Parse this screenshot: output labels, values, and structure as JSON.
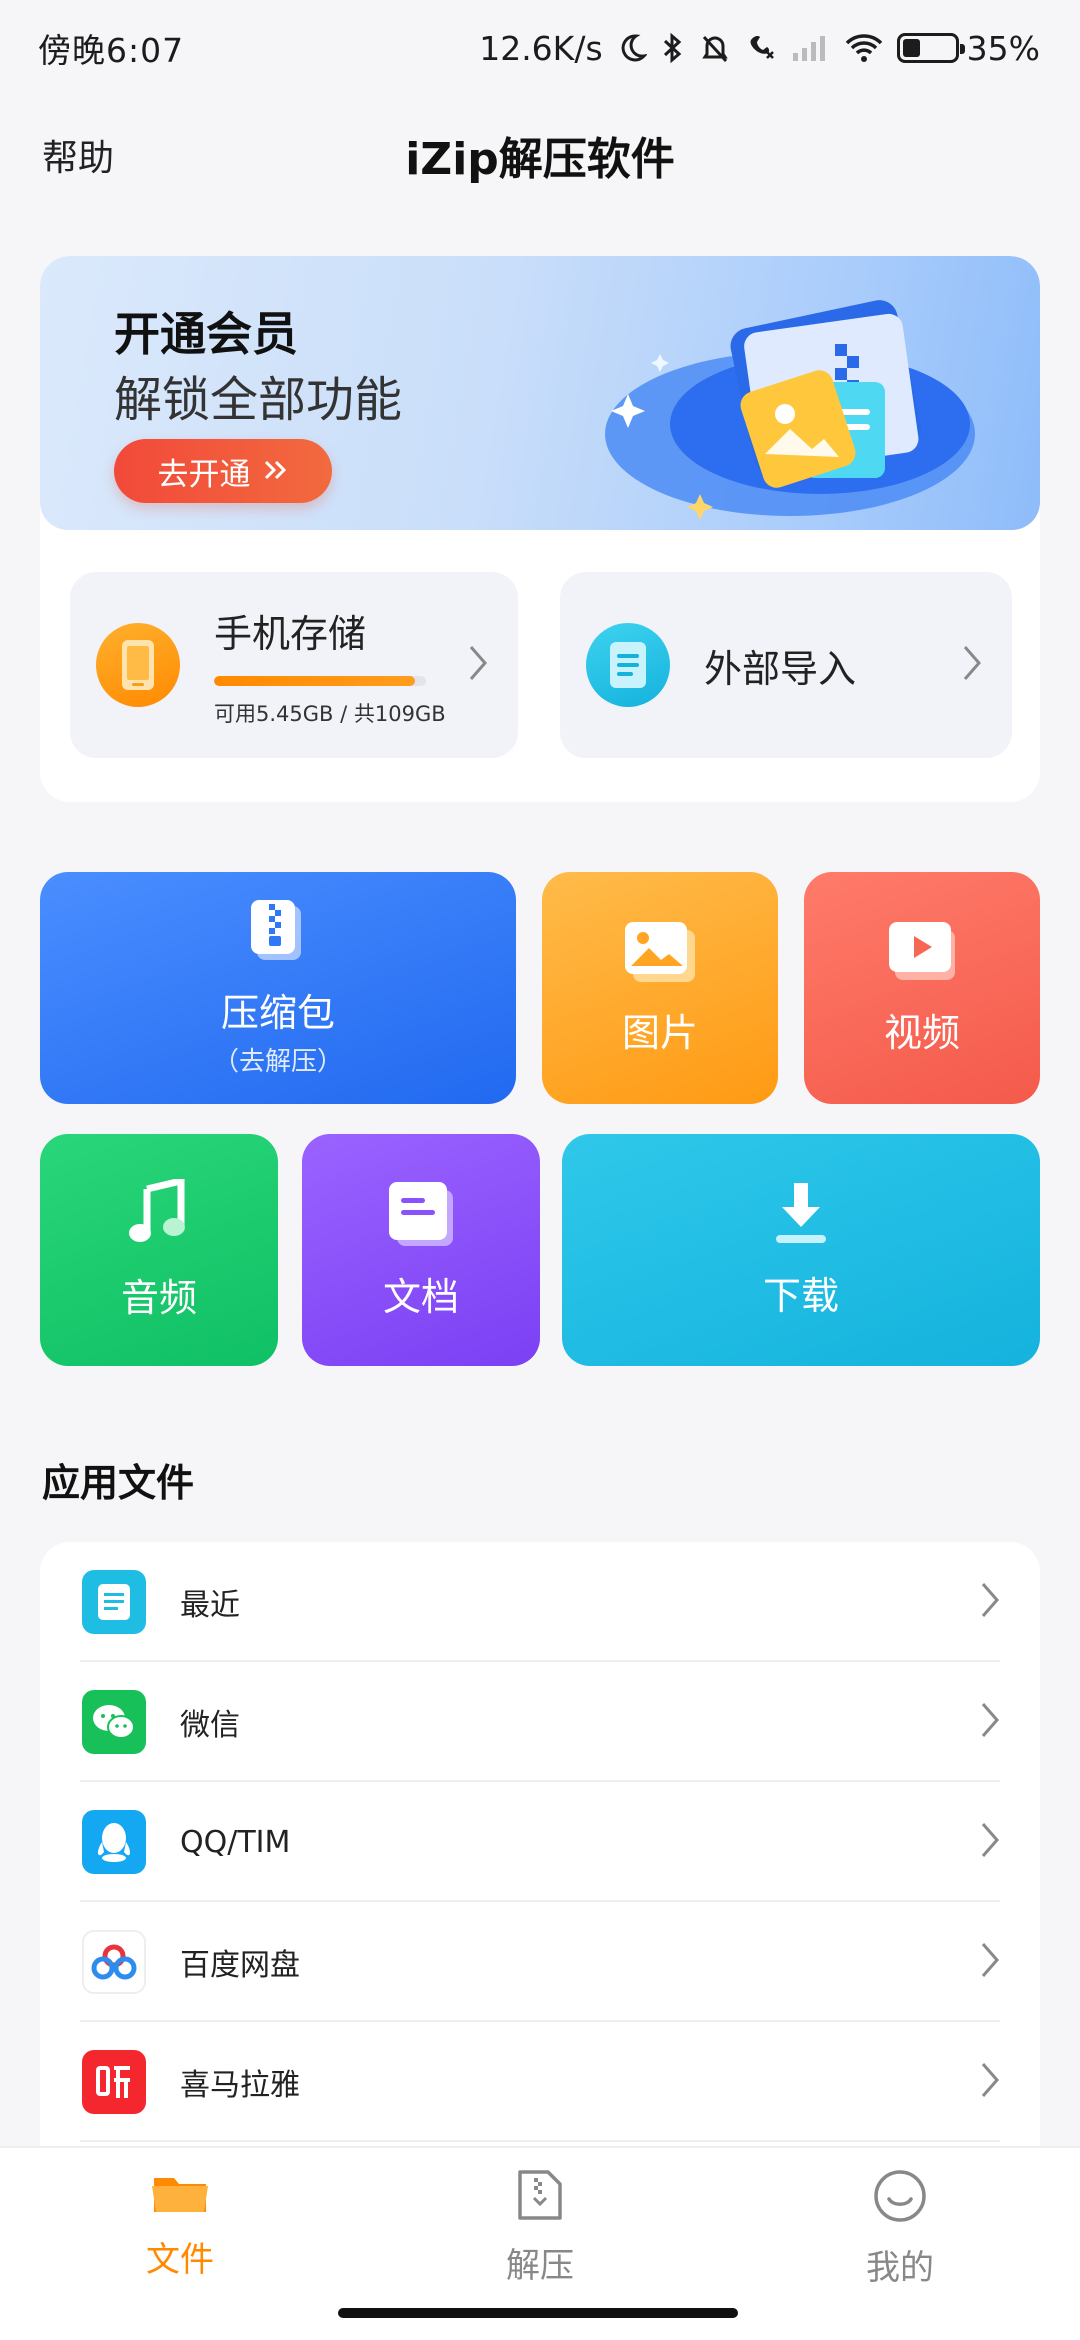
{
  "status_bar": {
    "time": "傍晚6:07",
    "net_speed": "12.6K/s",
    "battery_percent": "35%"
  },
  "header": {
    "help": "帮助",
    "title": "iZip解压软件"
  },
  "vip_banner": {
    "title": "开通会员",
    "subtitle": "解锁全部功能",
    "button": "去开通"
  },
  "storage": {
    "phone": {
      "name": "手机存储",
      "detail": "可用5.45GB / 共109GB",
      "used_fraction": 0.95
    },
    "import": {
      "name": "外部导入"
    }
  },
  "categories": {
    "zip": {
      "label": "压缩包",
      "sub": "（去解压）"
    },
    "image": {
      "label": "图片"
    },
    "video": {
      "label": "视频"
    },
    "audio": {
      "label": "音频"
    },
    "document": {
      "label": "文档"
    },
    "download": {
      "label": "下载"
    }
  },
  "app_files": {
    "title": "应用文件",
    "items": [
      {
        "label": "最近"
      },
      {
        "label": "微信"
      },
      {
        "label": "QQ/TIM"
      },
      {
        "label": "百度网盘"
      },
      {
        "label": "喜马拉雅"
      }
    ]
  },
  "bottom_nav": {
    "files": "文件",
    "unzip": "解压",
    "me": "我的"
  },
  "colors": {
    "accent": "#ff8a00",
    "zip": "#2f78f7",
    "image": "#ffa523",
    "video": "#f86656",
    "audio": "#17c96c",
    "document": "#8a52fb",
    "download": "#1fbde4"
  }
}
